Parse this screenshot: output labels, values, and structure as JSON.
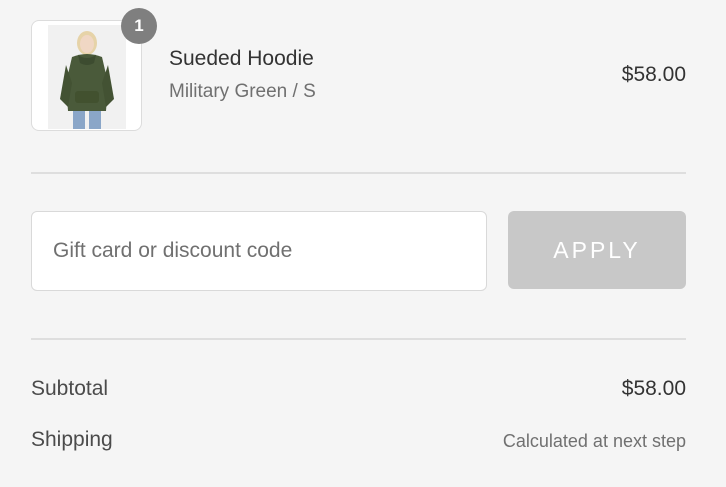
{
  "product": {
    "quantity": "1",
    "name": "Sueded Hoodie",
    "variant": "Military Green / S",
    "price": "$58.00",
    "image_icon": "hoodie-product-photo"
  },
  "discount": {
    "placeholder": "Gift card or discount code",
    "value": "",
    "apply_label": "APPLY"
  },
  "totals": {
    "subtotal_label": "Subtotal",
    "subtotal_value": "$58.00",
    "shipping_label": "Shipping",
    "shipping_value": "Calculated at next step"
  },
  "colors": {
    "background": "#f5f5f5",
    "badge": "#7f7f7f",
    "apply_button_disabled": "#c8c8c8",
    "hoodie": "#4a5a3a"
  }
}
